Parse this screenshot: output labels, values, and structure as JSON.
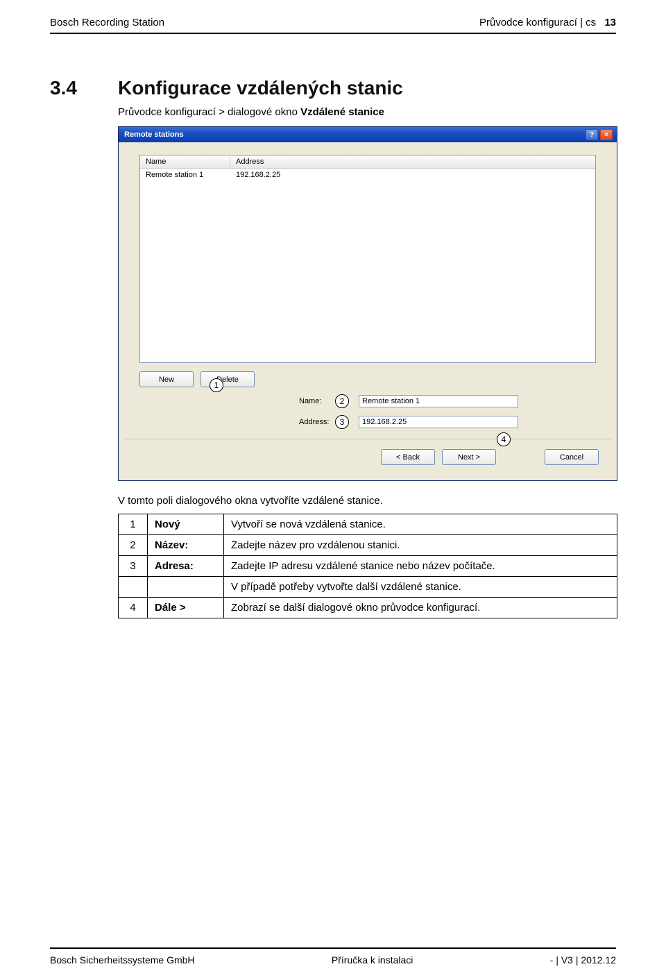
{
  "header": {
    "left": "Bosch Recording Station",
    "right_prefix": "Průvodce konfigurací | cs",
    "page_number": "13"
  },
  "section": {
    "number": "3.4",
    "title": "Konfigurace vzdálených stanic"
  },
  "breadcrumb": {
    "prefix": "Průvodce konfigurací > dialogové okno ",
    "strong": "Vzdálené stanice"
  },
  "dialog": {
    "title": "Remote stations",
    "help_symbol": "?",
    "close_symbol": "×",
    "list": {
      "col_name": "Name",
      "col_addr": "Address",
      "row1_name": "Remote station 1",
      "row1_addr": "192.168.2.25"
    },
    "buttons": {
      "new": "New",
      "delete": "Delete"
    },
    "form": {
      "name_label": "Name:",
      "name_value": "Remote station 1",
      "addr_label": "Address:",
      "addr_value": "192.168.2.25"
    },
    "nav": {
      "back": "< Back",
      "next": "Next >",
      "cancel": "Cancel"
    }
  },
  "callouts": {
    "c1": "1",
    "c2": "2",
    "c3": "3",
    "c4": "4"
  },
  "paragraph": "V tomto poli dialogového okna vytvoříte vzdálené stanice.",
  "table": {
    "r1": {
      "num": "1",
      "label": "Nový",
      "desc": "Vytvoří se nová vzdálená stanice."
    },
    "r2": {
      "num": "2",
      "label": "Název:",
      "desc": "Zadejte název pro vzdálenou stanici."
    },
    "r3": {
      "num": "3",
      "label": "Adresa:",
      "desc": "Zadejte IP adresu vzdálené stanice nebo název počítače."
    },
    "r3b": {
      "desc": "V případě potřeby vytvořte další vzdálené stanice."
    },
    "r4": {
      "num": "4",
      "label": "Dále >",
      "desc": "Zobrazí se další dialogové okno průvodce konfigurací."
    }
  },
  "footer": {
    "left": "Bosch Sicherheitssysteme GmbH",
    "center": "Příručka k instalaci",
    "right": "- | V3 | 2012.12"
  }
}
